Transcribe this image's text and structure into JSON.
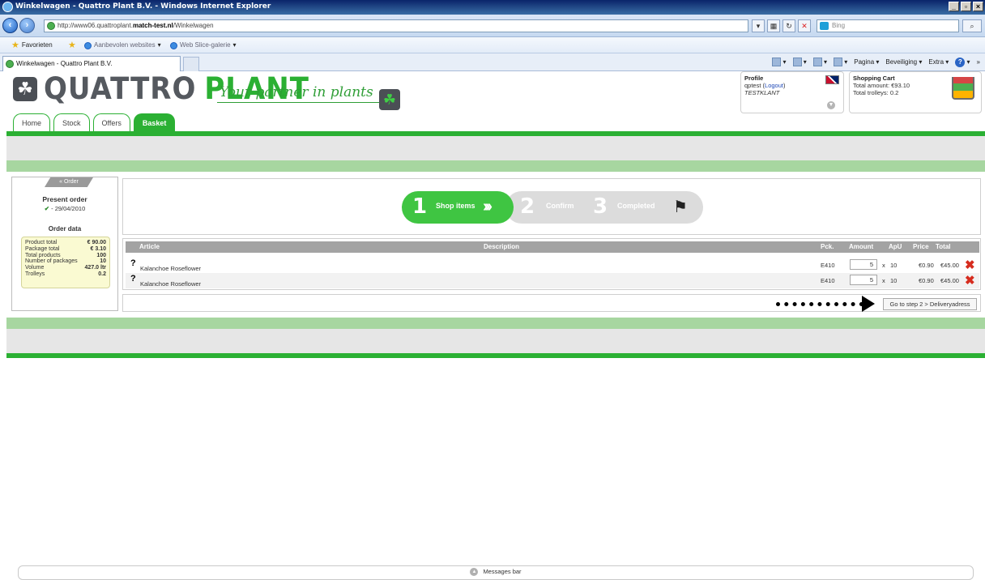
{
  "browser": {
    "window_title": "Winkelwagen - Quattro Plant B.V. - Windows Internet Explorer",
    "url_prefix": "http://www06.quattroplant.",
    "url_domain": "match-test.nl",
    "url_suffix": "/Winkelwagen",
    "search_placeholder": "Bing",
    "favorites": {
      "favorites_label": "Favorieten",
      "suggested_sites": "Aanbevolen websites",
      "web_slice": "Web Slice-galerie"
    },
    "tab_title": "Winkelwagen - Quattro Plant B.V.",
    "commands": {
      "page": "Pagina",
      "security": "Beveiliging",
      "extra": "Extra"
    }
  },
  "header": {
    "logo_quattro": "QUATTRO",
    "logo_plant": "PLANT",
    "tagline": "Your partner in plants"
  },
  "profile": {
    "title": "Profile",
    "user": "qptest",
    "logout": "Logout",
    "company": "TESTKLANT"
  },
  "cart": {
    "title": "Shopping Cart",
    "total_amount": "Total amount: €93.10",
    "total_trolleys": "Total trolleys: 0.2"
  },
  "nav_tabs": [
    "Home",
    "Stock",
    "Offers",
    "Basket"
  ],
  "nav_active": "Basket",
  "sidebar": {
    "tab_label": "Order",
    "present_order": "Present order",
    "date": "- 29/04/2010",
    "order_data_title": "Order data",
    "rows": [
      {
        "label": "Product total",
        "value": "€ 90.00"
      },
      {
        "label": "Package total",
        "value": "€ 3.10"
      },
      {
        "label": "Total products",
        "value": "100"
      },
      {
        "label": "Number of packages",
        "value": "10"
      },
      {
        "label": "Volume",
        "value": "427.0 ltr"
      },
      {
        "label": "Trolleys",
        "value": "0.2"
      }
    ]
  },
  "steps": [
    {
      "num": "1",
      "label": "Shop items",
      "state": "active"
    },
    {
      "num": "2",
      "label": "Confirm",
      "state": "inactive"
    },
    {
      "num": "3",
      "label": "Completed",
      "state": "inactive"
    }
  ],
  "table": {
    "headers": {
      "article": "Article",
      "description": "Description",
      "pck": "Pck.",
      "amount": "Amount",
      "apu": "ApU",
      "price": "Price",
      "total": "Total"
    },
    "rows": [
      {
        "q": "?",
        "article": "Kalanchoe Roseflower",
        "pck": "E410",
        "amount": "5",
        "x": "x",
        "apu": "10",
        "price": "€0.90",
        "total": "€45.00"
      },
      {
        "q": "?",
        "article": "Kalanchoe Roseflower",
        "pck": "E410",
        "amount": "5",
        "x": "x",
        "apu": "10",
        "price": "€0.90",
        "total": "€45.00"
      }
    ]
  },
  "next_button": "Go to step 2 > Deliveryadress",
  "messages_bar": "Messages bar",
  "colors": {
    "brand_green": "#2bb033",
    "step_green": "#3fc542",
    "delete_red": "#d62c1e"
  }
}
